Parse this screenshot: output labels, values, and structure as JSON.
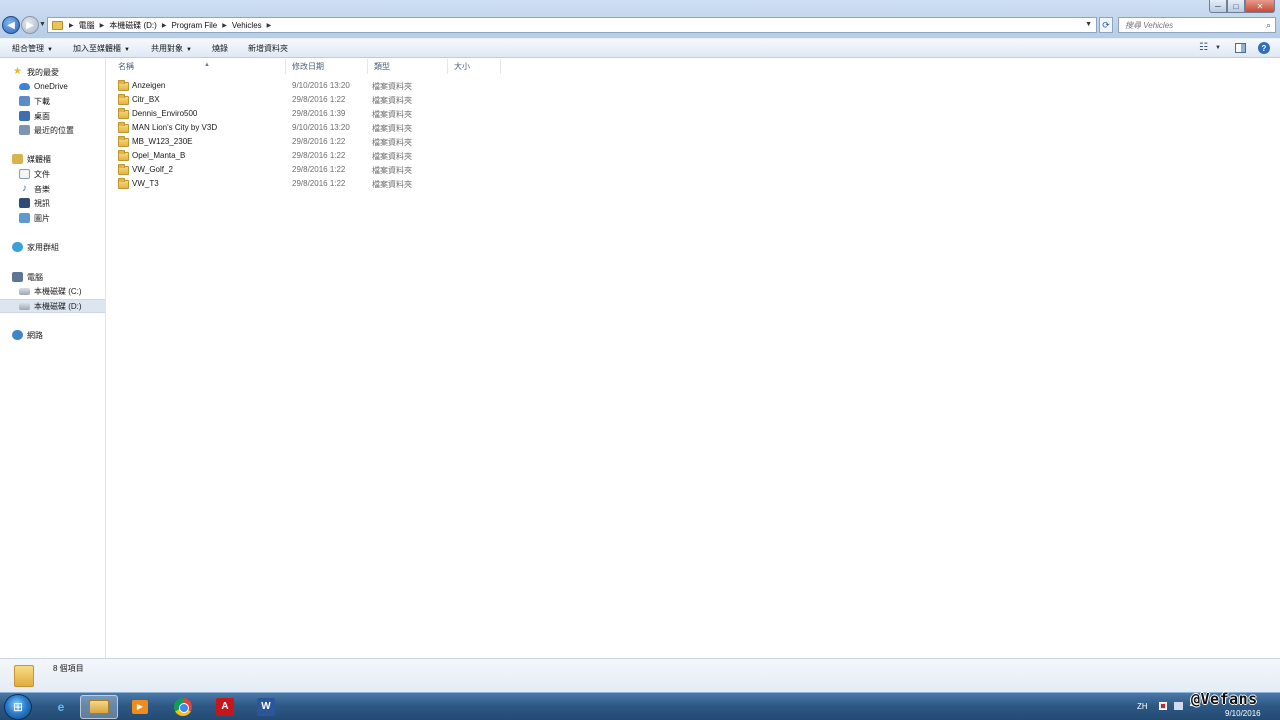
{
  "window": {
    "controls": {
      "minimize": "─",
      "maximize": "□",
      "close": "✕"
    }
  },
  "address": {
    "crumbs": [
      "電腦",
      "本機磁碟 (D:)",
      "Program File",
      "Vehicles"
    ],
    "separator": "▶"
  },
  "search": {
    "placeholder": "搜尋 Vehicles"
  },
  "toolbar": {
    "organize": "組合管理",
    "add_to_library": "加入至媒體櫃",
    "share_with": "共用對象",
    "burn": "燒錄",
    "new_folder": "新增資料夾"
  },
  "sidebar": {
    "favorites": "我的最愛",
    "onedrive": "OneDrive",
    "downloads": "下載",
    "desktop": "桌面",
    "recent": "最近的位置",
    "libraries": "媒體櫃",
    "documents": "文件",
    "music": "音樂",
    "videos": "視訊",
    "pictures": "圖片",
    "homegroup": "家用群組",
    "computer": "電腦",
    "drive_c": "本機磁碟 (C:)",
    "drive_d": "本機磁碟 (D:)",
    "network": "網路"
  },
  "columns": {
    "name": "名稱",
    "modified": "修改日期",
    "type": "類型",
    "size": "大小"
  },
  "files": [
    {
      "name": "Anzeigen",
      "modified": "9/10/2016 13:20",
      "type": "檔案資料夾"
    },
    {
      "name": "Citr_BX",
      "modified": "29/8/2016 1:22",
      "type": "檔案資料夾"
    },
    {
      "name": "Dennis_Enviro500",
      "modified": "29/8/2016 1:39",
      "type": "檔案資料夾"
    },
    {
      "name": "MAN Lion's City by V3D",
      "modified": "9/10/2016 13:20",
      "type": "檔案資料夾"
    },
    {
      "name": "MB_W123_230E",
      "modified": "29/8/2016 1:22",
      "type": "檔案資料夾"
    },
    {
      "name": "Opel_Manta_B",
      "modified": "29/8/2016 1:22",
      "type": "檔案資料夾"
    },
    {
      "name": "VW_Golf_2",
      "modified": "29/8/2016 1:22",
      "type": "檔案資料夾"
    },
    {
      "name": "VW_T3",
      "modified": "29/8/2016 1:22",
      "type": "檔案資料夾"
    }
  ],
  "details": {
    "item_count": "8 個項目"
  },
  "taskbar": {
    "acrobat_glyph": "A",
    "word_glyph": "W",
    "lang": "ZH",
    "date": "9/10/2016",
    "watermark": "@Vefans"
  }
}
